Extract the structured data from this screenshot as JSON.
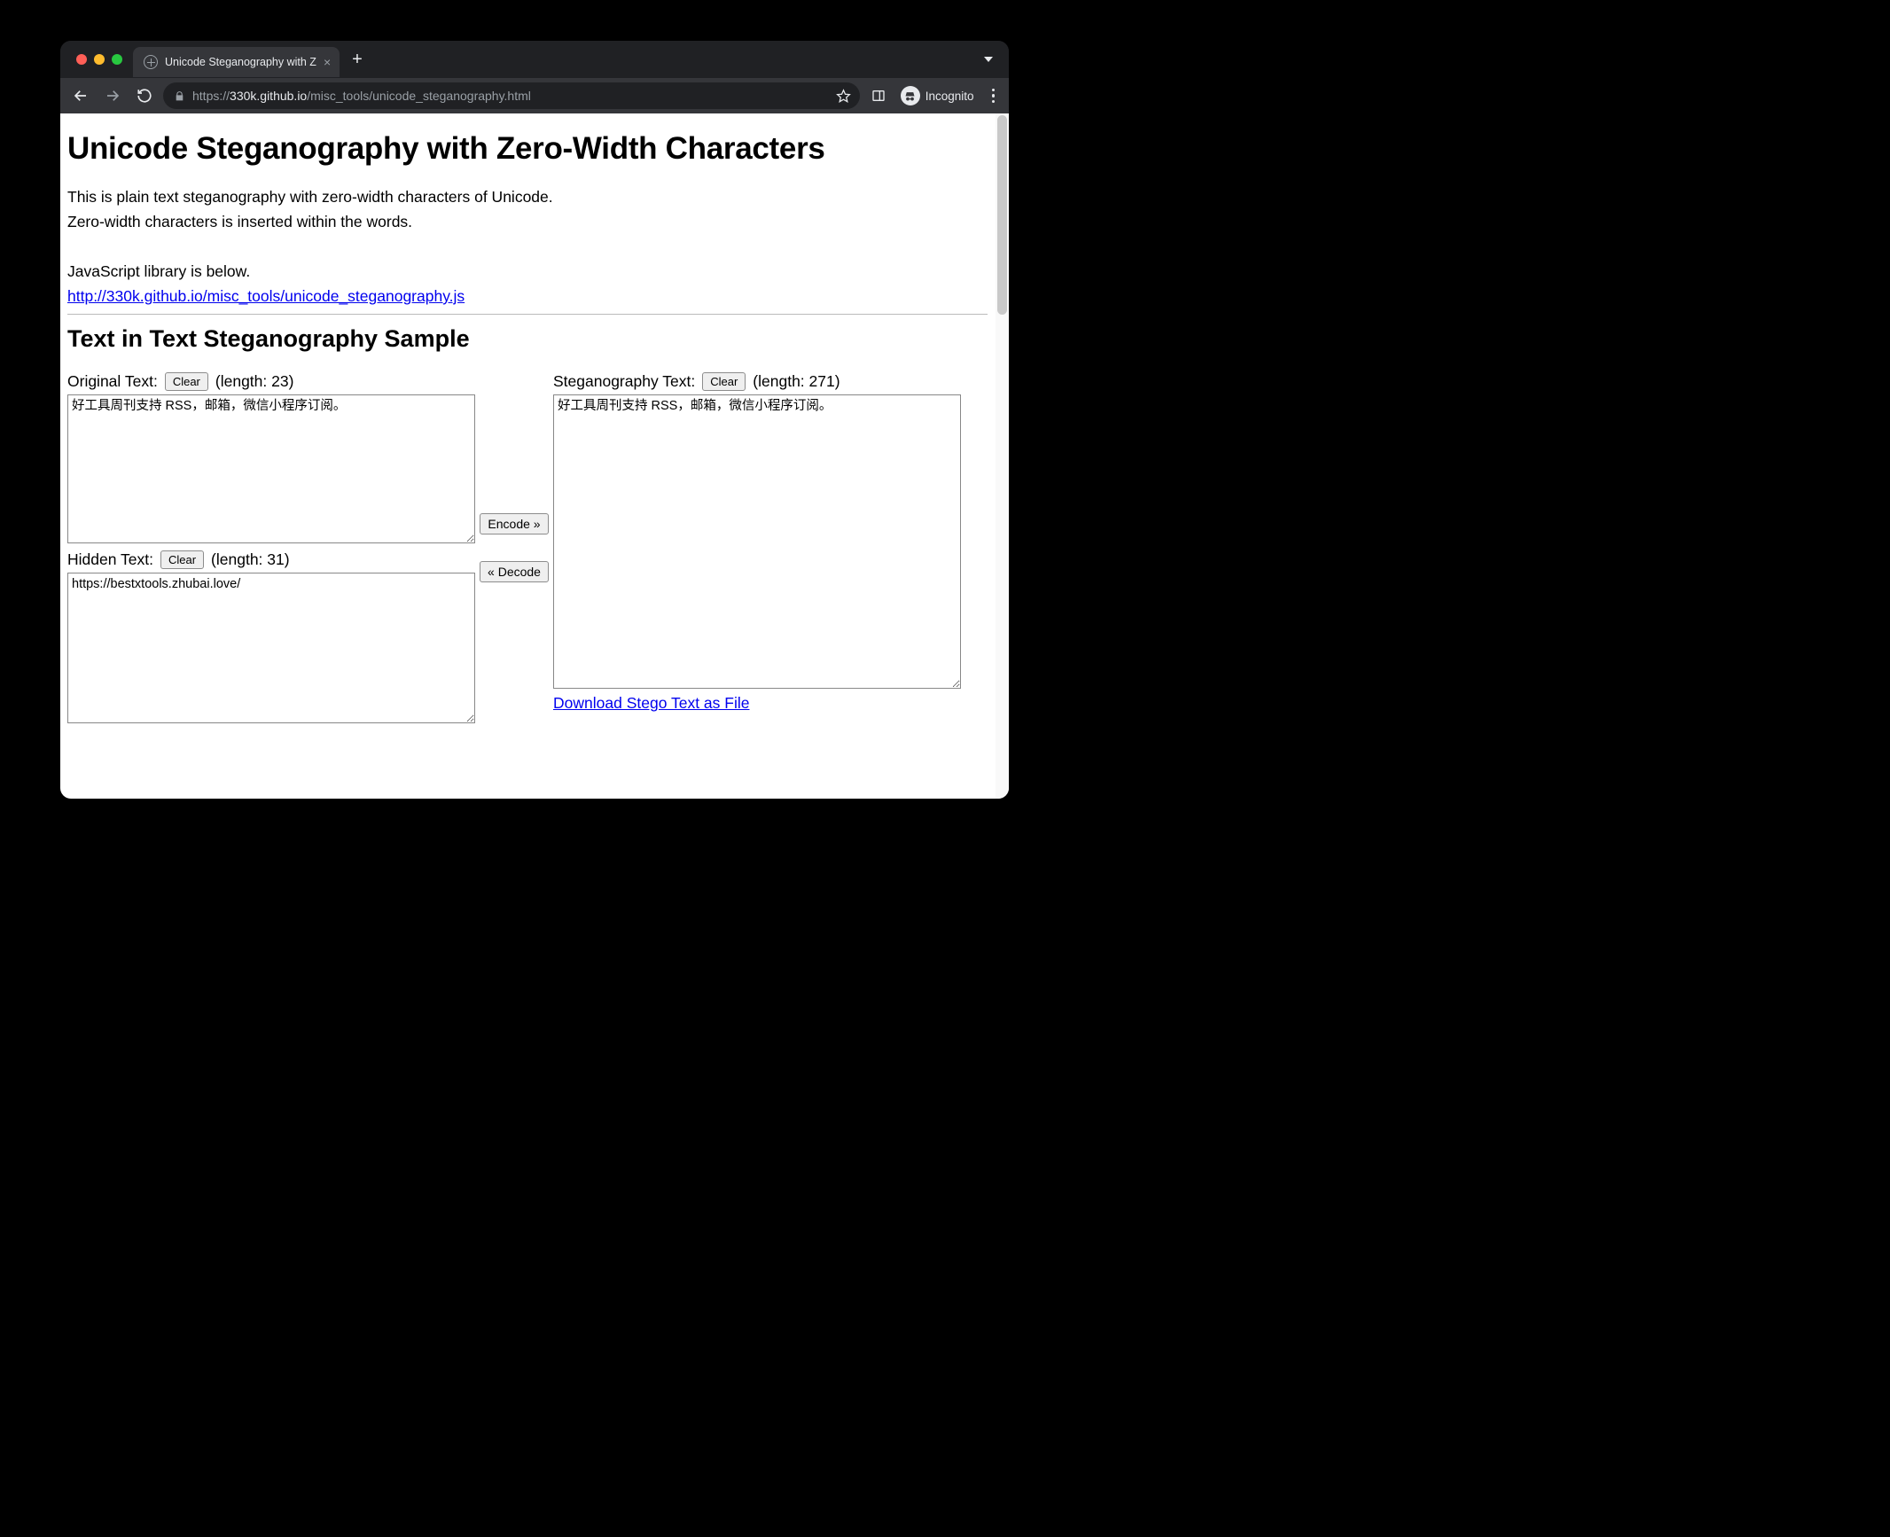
{
  "browser": {
    "tab_title": "Unicode Steganography with Z",
    "new_tab_glyph": "+",
    "tab_close_glyph": "×",
    "url_protocol": "https://",
    "url_host": "330k.github.io",
    "url_path": "/misc_tools/unicode_steganography.html",
    "incognito_label": "Incognito"
  },
  "page": {
    "h1": "Unicode Steganography with Zero-Width Characters",
    "intro_line1": "This is plain text steganography with zero-width characters of Unicode.",
    "intro_line2": "Zero-width characters is inserted within the words.",
    "intro_line3": "JavaScript library is below.",
    "lib_link": "http://330k.github.io/misc_tools/unicode_steganography.js",
    "h2": "Text in Text Steganography Sample",
    "original": {
      "label": "Original Text:",
      "clear": "Clear",
      "length_label": "(length: 23)",
      "value": "好工具周刊支持 RSS，邮箱，微信小程序订阅。"
    },
    "hidden": {
      "label": "Hidden Text:",
      "clear": "Clear",
      "length_label": "(length: 31)",
      "value": "https://bestxtools.zhubai.love/"
    },
    "stego": {
      "label": "Steganography Text:",
      "clear": "Clear",
      "length_label": "(length: 271)",
      "value": "好工具周刊支持 RSS，邮箱，微信小程序订阅。"
    },
    "encode_btn": "Encode »",
    "decode_btn": "« Decode",
    "download_link": "Download Stego Text as File"
  }
}
